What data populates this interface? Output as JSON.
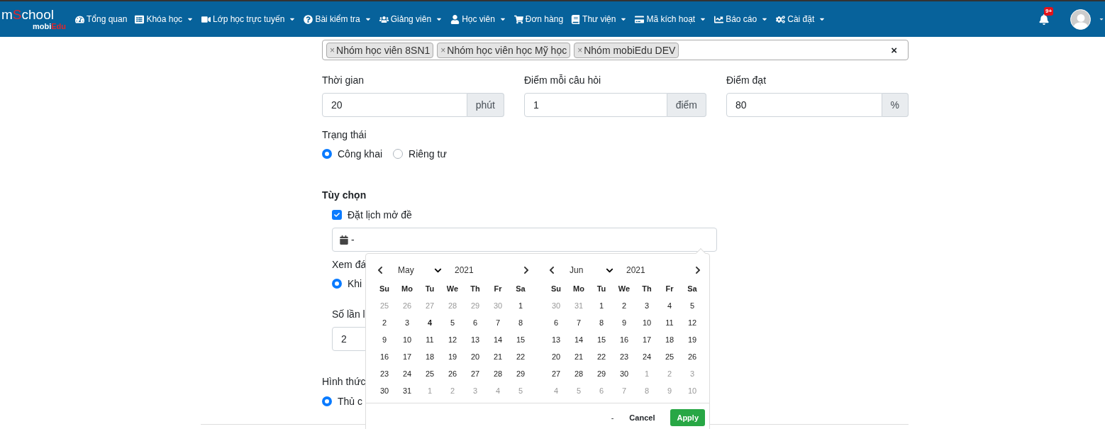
{
  "navbar": {
    "logo": {
      "title": [
        {
          "text": "m",
          "color": "#ffffff"
        },
        {
          "text": "S",
          "color": "#e5252a"
        },
        {
          "text": "chool",
          "color": "#ffffff"
        }
      ],
      "subtitle": [
        {
          "text": "mobi",
          "color": "#ffffff"
        },
        {
          "text": "Edu",
          "color": "#e5252a"
        }
      ]
    },
    "items": [
      {
        "label": "Tổng quan",
        "has_menu": false
      },
      {
        "label": "Khóa học",
        "has_menu": true
      },
      {
        "label": "Lớp học trực tuyến",
        "has_menu": true
      },
      {
        "label": "Bài kiểm tra",
        "has_menu": true
      },
      {
        "label": "Giảng viên",
        "has_menu": true
      },
      {
        "label": "Học viên",
        "has_menu": true
      },
      {
        "label": "Đơn hàng",
        "has_menu": false
      },
      {
        "label": "Thư viện",
        "has_menu": true
      },
      {
        "label": "Mã kích hoạt",
        "has_menu": true
      },
      {
        "label": "Báo cáo",
        "has_menu": true
      },
      {
        "label": "Cài đặt",
        "has_menu": true
      }
    ],
    "notification_badge": "9+"
  },
  "form": {
    "groups_tags": [
      "Nhóm học viên 8SN1",
      "Nhóm học viên học Mỹ học",
      "Nhóm mobiEdu DEV"
    ],
    "remove_symbol": "×",
    "clear_symbol": "×",
    "fields": [
      {
        "label": "Thời gian",
        "value": "20",
        "unit": "phút"
      },
      {
        "label": "Điểm mỗi câu hỏi",
        "value": "1",
        "unit": "điểm"
      },
      {
        "label": "Điểm đạt",
        "value": "80",
        "unit": "%"
      }
    ],
    "status": {
      "label": "Trạng thái",
      "options": [
        {
          "label": "Công khai",
          "selected": true
        },
        {
          "label": "Riêng tư",
          "selected": false
        }
      ]
    },
    "options_heading": "Tùy chọn",
    "schedule": {
      "label": "Đặt lịch mở đề",
      "checked": true,
      "value": "-"
    },
    "view_answers": {
      "label": "Xem đá",
      "options": [
        {
          "label": "Khi",
          "selected": true
        }
      ]
    },
    "attempts": {
      "label": "Số lần l",
      "value": "2"
    },
    "method": {
      "label": "Hình thức",
      "options": [
        {
          "label": "Thủ c",
          "selected": true
        }
      ]
    }
  },
  "date_picker": {
    "months": [
      {
        "month": "May",
        "year": "2021",
        "weekdays": [
          "Su",
          "Mo",
          "Tu",
          "We",
          "Th",
          "Fr",
          "Sa"
        ],
        "days": [
          {
            "d": "25",
            "kind": "out"
          },
          {
            "d": "26",
            "kind": "out"
          },
          {
            "d": "27",
            "kind": "out"
          },
          {
            "d": "28",
            "kind": "out"
          },
          {
            "d": "29",
            "kind": "out"
          },
          {
            "d": "30",
            "kind": "out"
          },
          {
            "d": "1",
            "kind": "in"
          },
          {
            "d": "2",
            "kind": "in"
          },
          {
            "d": "3",
            "kind": "in"
          },
          {
            "d": "4",
            "kind": "today"
          },
          {
            "d": "5",
            "kind": "in"
          },
          {
            "d": "6",
            "kind": "in"
          },
          {
            "d": "7",
            "kind": "in"
          },
          {
            "d": "8",
            "kind": "in"
          },
          {
            "d": "9",
            "kind": "in"
          },
          {
            "d": "10",
            "kind": "in"
          },
          {
            "d": "11",
            "kind": "in"
          },
          {
            "d": "12",
            "kind": "in"
          },
          {
            "d": "13",
            "kind": "in"
          },
          {
            "d": "14",
            "kind": "in"
          },
          {
            "d": "15",
            "kind": "in"
          },
          {
            "d": "16",
            "kind": "in"
          },
          {
            "d": "17",
            "kind": "in"
          },
          {
            "d": "18",
            "kind": "in"
          },
          {
            "d": "19",
            "kind": "in"
          },
          {
            "d": "20",
            "kind": "in"
          },
          {
            "d": "21",
            "kind": "in"
          },
          {
            "d": "22",
            "kind": "in"
          },
          {
            "d": "23",
            "kind": "in"
          },
          {
            "d": "24",
            "kind": "in"
          },
          {
            "d": "25",
            "kind": "in"
          },
          {
            "d": "26",
            "kind": "in"
          },
          {
            "d": "27",
            "kind": "in"
          },
          {
            "d": "28",
            "kind": "in"
          },
          {
            "d": "29",
            "kind": "in"
          },
          {
            "d": "30",
            "kind": "in"
          },
          {
            "d": "31",
            "kind": "in"
          },
          {
            "d": "1",
            "kind": "out"
          },
          {
            "d": "2",
            "kind": "out"
          },
          {
            "d": "3",
            "kind": "out"
          },
          {
            "d": "4",
            "kind": "out"
          },
          {
            "d": "5",
            "kind": "out"
          }
        ]
      },
      {
        "month": "Jun",
        "year": "2021",
        "weekdays": [
          "Su",
          "Mo",
          "Tu",
          "We",
          "Th",
          "Fr",
          "Sa"
        ],
        "days": [
          {
            "d": "30",
            "kind": "out"
          },
          {
            "d": "31",
            "kind": "out"
          },
          {
            "d": "1",
            "kind": "in"
          },
          {
            "d": "2",
            "kind": "in"
          },
          {
            "d": "3",
            "kind": "in"
          },
          {
            "d": "4",
            "kind": "in"
          },
          {
            "d": "5",
            "kind": "in"
          },
          {
            "d": "6",
            "kind": "in"
          },
          {
            "d": "7",
            "kind": "in"
          },
          {
            "d": "8",
            "kind": "in"
          },
          {
            "d": "9",
            "kind": "in"
          },
          {
            "d": "10",
            "kind": "in"
          },
          {
            "d": "11",
            "kind": "in"
          },
          {
            "d": "12",
            "kind": "in"
          },
          {
            "d": "13",
            "kind": "in"
          },
          {
            "d": "14",
            "kind": "in"
          },
          {
            "d": "15",
            "kind": "in"
          },
          {
            "d": "16",
            "kind": "in"
          },
          {
            "d": "17",
            "kind": "in"
          },
          {
            "d": "18",
            "kind": "in"
          },
          {
            "d": "19",
            "kind": "in"
          },
          {
            "d": "20",
            "kind": "in"
          },
          {
            "d": "21",
            "kind": "in"
          },
          {
            "d": "22",
            "kind": "in"
          },
          {
            "d": "23",
            "kind": "in"
          },
          {
            "d": "24",
            "kind": "in"
          },
          {
            "d": "25",
            "kind": "in"
          },
          {
            "d": "26",
            "kind": "in"
          },
          {
            "d": "27",
            "kind": "in"
          },
          {
            "d": "28",
            "kind": "in"
          },
          {
            "d": "29",
            "kind": "in"
          },
          {
            "d": "30",
            "kind": "in"
          },
          {
            "d": "1",
            "kind": "out"
          },
          {
            "d": "2",
            "kind": "out"
          },
          {
            "d": "3",
            "kind": "out"
          },
          {
            "d": "4",
            "kind": "out"
          },
          {
            "d": "5",
            "kind": "out"
          },
          {
            "d": "6",
            "kind": "out"
          },
          {
            "d": "7",
            "kind": "out"
          },
          {
            "d": "8",
            "kind": "out"
          },
          {
            "d": "9",
            "kind": "out"
          },
          {
            "d": "10",
            "kind": "out"
          }
        ]
      }
    ],
    "selected_range": "-",
    "cancel": "Cancel",
    "apply": "Apply"
  }
}
